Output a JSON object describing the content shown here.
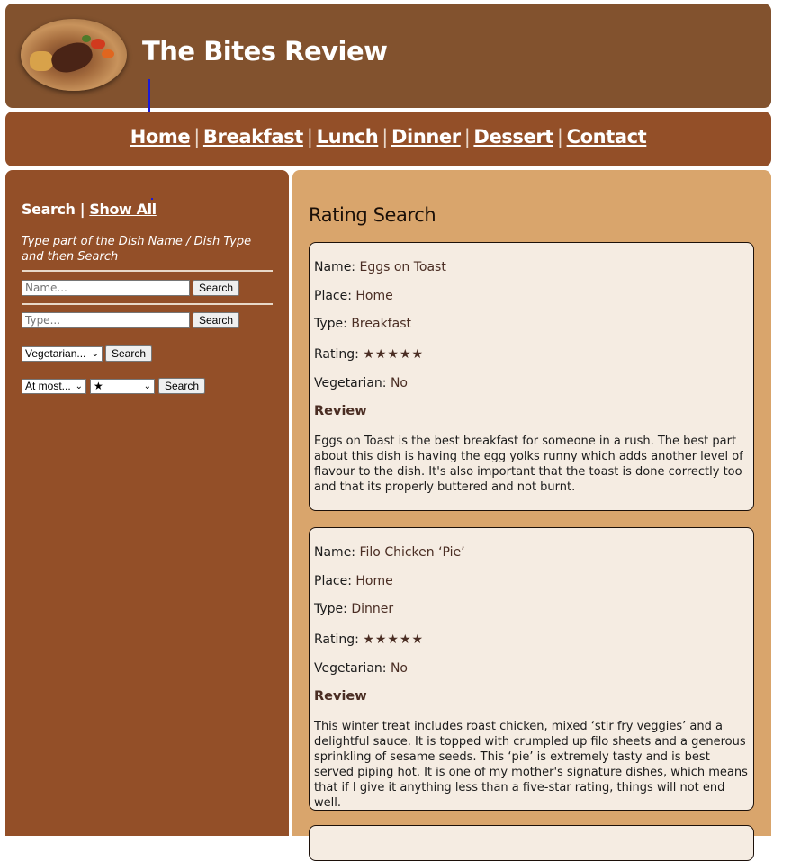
{
  "header": {
    "title": "The Bites Review"
  },
  "nav": {
    "items": [
      "Home",
      "Breakfast",
      "Lunch",
      "Dinner",
      "Dessert",
      "Contact"
    ],
    "separator": "|"
  },
  "sidebar": {
    "search_label": "Search",
    "separator": "|",
    "show_all_label": "Show All",
    "hint": "Type part of the Dish Name / Dish Type and then Search",
    "name_placeholder": "Name...",
    "type_placeholder": "Type...",
    "search_button": "Search",
    "vegetarian_select": "Vegetarian...",
    "rating_mode_select": "At most...",
    "rating_value_select": "★"
  },
  "main": {
    "title": "Rating Search",
    "field_labels": {
      "name": "Name:",
      "place": "Place:",
      "type": "Type:",
      "rating": "Rating:",
      "vegetarian": "Vegetarian:",
      "review": "Review"
    },
    "reviews": [
      {
        "name": "Eggs on Toast",
        "place": "Home",
        "type": "Breakfast",
        "rating": "★★★★★",
        "vegetarian": "No",
        "review": "Eggs on Toast is the best breakfast for someone in a rush. The best part about this dish is having the egg yolks runny which adds another level of flavour to the dish. It's also important that the toast is done correctly too and that its properly buttered and not burnt."
      },
      {
        "name": "Filo Chicken ‘Pie’",
        "place": "Home",
        "type": "Dinner",
        "rating": "★★★★★",
        "vegetarian": "No",
        "review": "This winter treat includes roast chicken, mixed ‘stir fry veggies’ and a delightful sauce. It is topped with crumpled up filo sheets and a generous sprinkling of sesame seeds. This ‘pie’ is extremely tasty and is best served piping hot. It is one of my mother's signature dishes, which means that if I give it anything less than a five-star rating, things will not end well."
      }
    ]
  },
  "colors": {
    "header": "#82522e",
    "nav": "#934f28",
    "sidebar": "#934f28",
    "main": "#d9a56c",
    "card": "#f5ece2"
  }
}
